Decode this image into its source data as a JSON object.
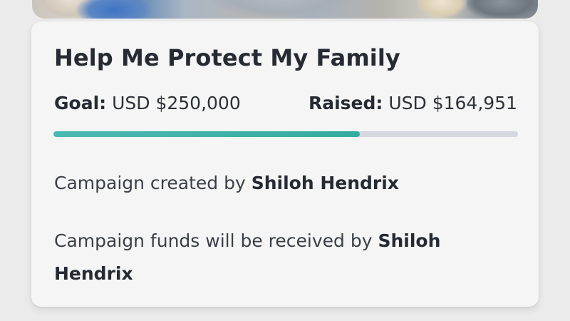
{
  "campaign": {
    "title": "Help Me Protect My Family",
    "goal_label": "Goal:",
    "goal_value": "USD $250,000",
    "raised_label": "Raised:",
    "raised_value": "USD $164,951",
    "progress_fraction": 0.66,
    "created_by_text": "Campaign created by",
    "creator_name": "Shiloh Hendrix",
    "received_by_text": "Campaign funds will be received by",
    "recipient_name": "Shiloh Hendrix"
  },
  "colors": {
    "progress_fill": "#3bb1a7",
    "progress_track": "#d5d8df",
    "card_background": "#f5f5f5"
  }
}
